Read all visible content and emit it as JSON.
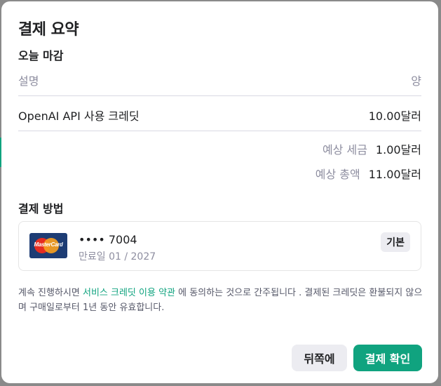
{
  "modal": {
    "title": "결제 요약"
  },
  "due_today": {
    "heading": "오늘 마감",
    "columns": {
      "description": "설명",
      "amount": "양"
    },
    "items": [
      {
        "description": "OpenAI API 사용 크레딧",
        "amount": "10.00달러"
      }
    ],
    "tax": {
      "label": "예상 세금",
      "value": "1.00달러"
    },
    "total": {
      "label": "예상 총액",
      "value": "11.00달러"
    }
  },
  "payment_method": {
    "heading": "결제 방법",
    "card": {
      "brand_icon": "mastercard-icon",
      "brand_text": "MasterCard",
      "masked_number": "•••• 7004",
      "expiry": "만료일 01 / 2027",
      "badge": "기본"
    }
  },
  "terms": {
    "prefix": "계속 진행하시면 ",
    "link": "서비스 크레딧 이용 약관",
    "suffix": " 에 동의하는 것으로 간주됩니다 . 결제된 크레딧은 환불되지 않으며 구매일로부터 1년 동안 유효합니다."
  },
  "buttons": {
    "back": "뒤쪽에",
    "confirm": "결제 확인"
  },
  "colors": {
    "accent": "#10a37f",
    "badge_bg": "#ececf1",
    "muted_text": "#8e8ea0"
  }
}
